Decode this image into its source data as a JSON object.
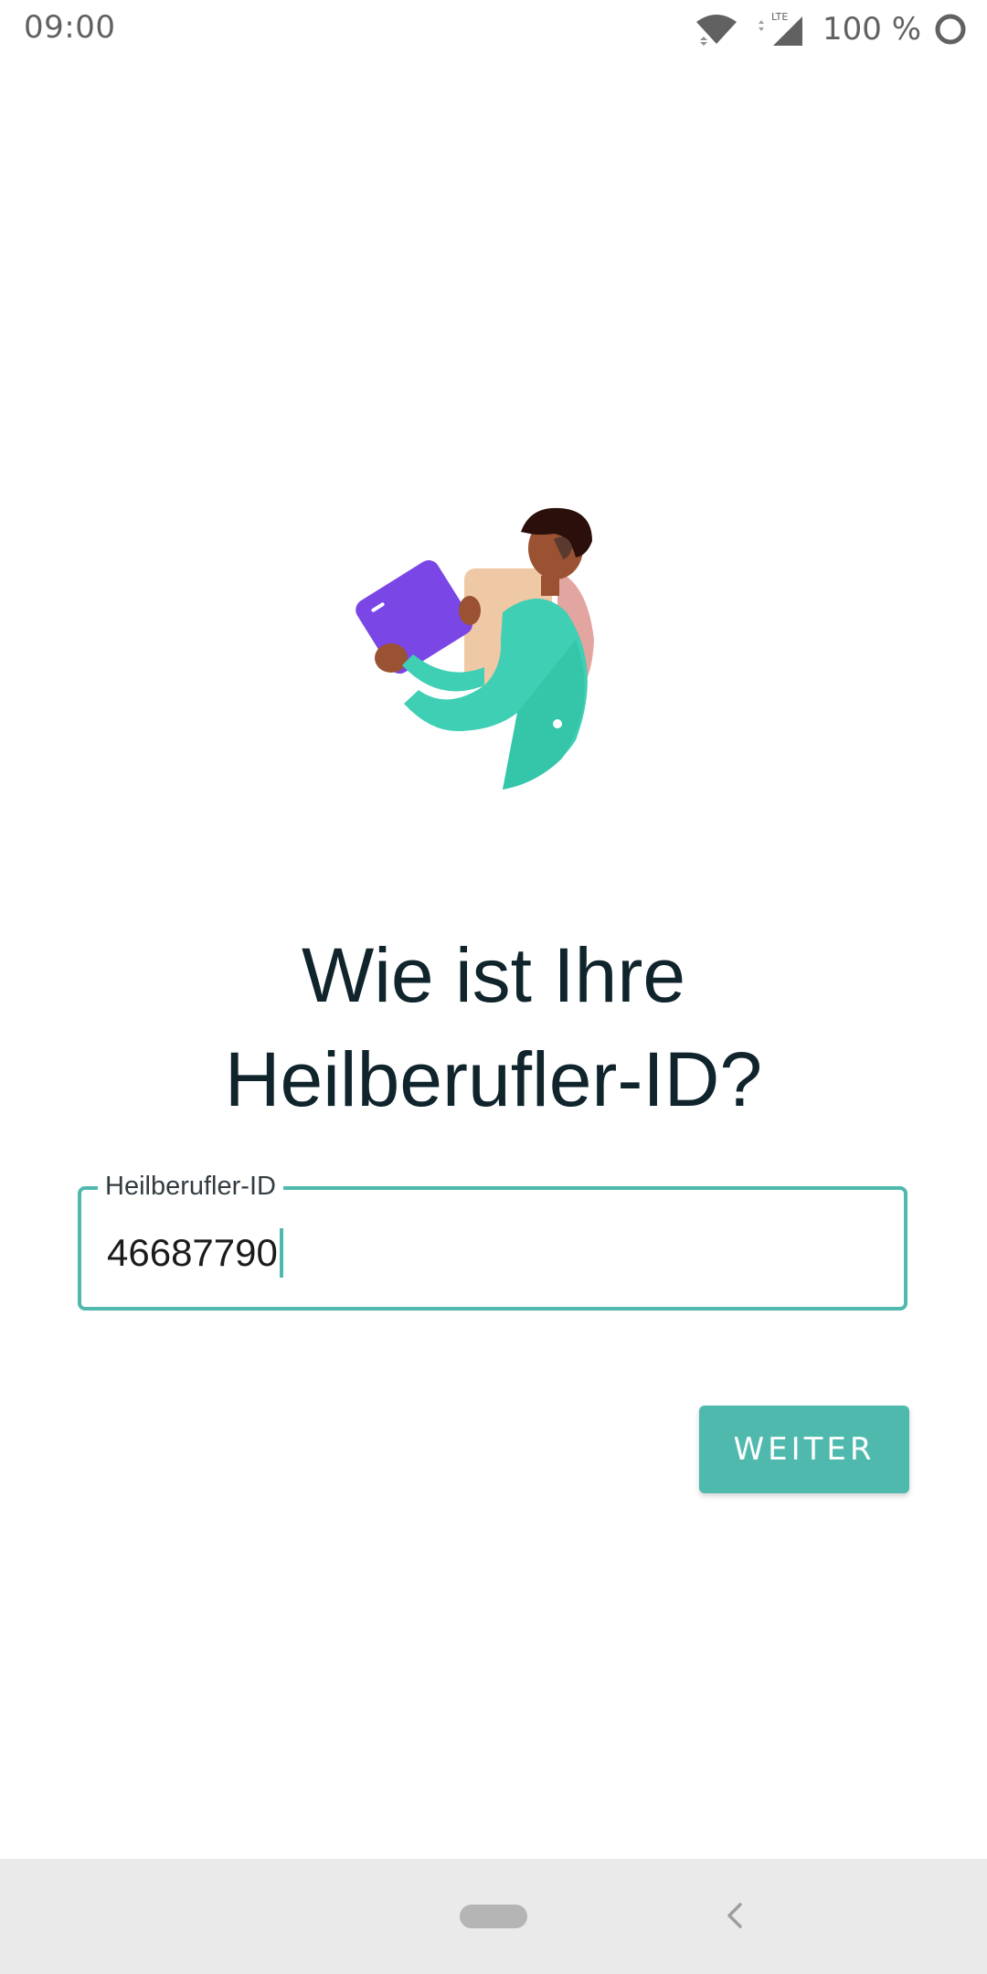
{
  "status_bar": {
    "time": "09:00",
    "network": "LTE",
    "battery": "100 %",
    "icons": [
      "wifi-icon",
      "signal-icon",
      "battery-icon"
    ]
  },
  "illustration": {
    "icon": "person-holding-tablet-illustration"
  },
  "main": {
    "title_line1": "Wie ist Ihre",
    "title_line2": "Heilberufler-ID?",
    "field": {
      "label": "Heilberufler-ID",
      "value": "46687790"
    },
    "next_button_label": "WEITER"
  },
  "nav_bar": {
    "icons": [
      "home-pill-icon",
      "back-icon"
    ]
  },
  "colors": {
    "accent": "#4fb9ae",
    "title": "#10242c",
    "nav_background": "#eaeaea"
  }
}
